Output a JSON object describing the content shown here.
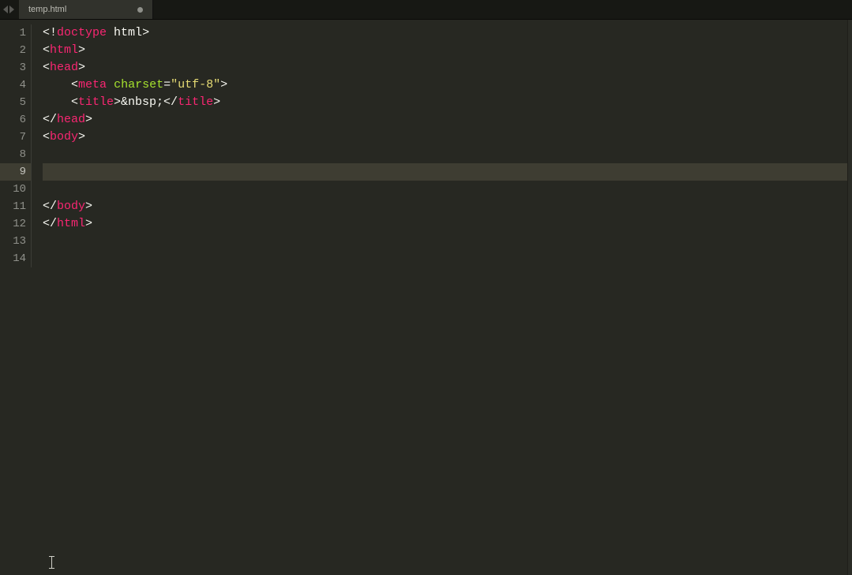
{
  "tabs": {
    "items": [
      {
        "label": "temp.html",
        "dirty": true,
        "active": true
      }
    ]
  },
  "editor": {
    "active_line": 9,
    "line_numbers": [
      "1",
      "2",
      "3",
      "4",
      "5",
      "6",
      "7",
      "8",
      "9",
      "10",
      "11",
      "12",
      "13",
      "14"
    ],
    "lines": [
      {
        "indent": 0,
        "tokens": [
          {
            "text": "<!",
            "cls": "c-white"
          },
          {
            "text": "doctype",
            "cls": "c-tag"
          },
          {
            "text": " ",
            "cls": "c-white"
          },
          {
            "text": "html",
            "cls": "c-white"
          },
          {
            "text": ">",
            "cls": "c-white"
          }
        ]
      },
      {
        "indent": 0,
        "tokens": [
          {
            "text": "<",
            "cls": "c-white"
          },
          {
            "text": "html",
            "cls": "c-tag"
          },
          {
            "text": ">",
            "cls": "c-white"
          }
        ]
      },
      {
        "indent": 0,
        "tokens": [
          {
            "text": "<",
            "cls": "c-white"
          },
          {
            "text": "head",
            "cls": "c-tag"
          },
          {
            "text": ">",
            "cls": "c-white"
          }
        ]
      },
      {
        "indent": 1,
        "tokens": [
          {
            "text": "<",
            "cls": "c-white"
          },
          {
            "text": "meta",
            "cls": "c-tag"
          },
          {
            "text": " ",
            "cls": "c-white"
          },
          {
            "text": "charset",
            "cls": "c-attr"
          },
          {
            "text": "=",
            "cls": "c-white"
          },
          {
            "text": "\"utf-8\"",
            "cls": "c-string"
          },
          {
            "text": ">",
            "cls": "c-white"
          }
        ]
      },
      {
        "indent": 1,
        "tokens": [
          {
            "text": "<",
            "cls": "c-white"
          },
          {
            "text": "title",
            "cls": "c-tag"
          },
          {
            "text": ">&nbsp;</",
            "cls": "c-white"
          },
          {
            "text": "title",
            "cls": "c-tag"
          },
          {
            "text": ">",
            "cls": "c-white"
          }
        ]
      },
      {
        "indent": 0,
        "tokens": [
          {
            "text": "</",
            "cls": "c-white"
          },
          {
            "text": "head",
            "cls": "c-tag"
          },
          {
            "text": ">",
            "cls": "c-white"
          }
        ]
      },
      {
        "indent": 0,
        "tokens": [
          {
            "text": "<",
            "cls": "c-white"
          },
          {
            "text": "body",
            "cls": "c-tag"
          },
          {
            "text": ">",
            "cls": "c-white"
          }
        ]
      },
      {
        "indent": 0,
        "tokens": []
      },
      {
        "indent": 0,
        "tokens": []
      },
      {
        "indent": 0,
        "tokens": []
      },
      {
        "indent": 0,
        "tokens": [
          {
            "text": "</",
            "cls": "c-white"
          },
          {
            "text": "body",
            "cls": "c-tag"
          },
          {
            "text": ">",
            "cls": "c-white"
          }
        ]
      },
      {
        "indent": 0,
        "tokens": [
          {
            "text": "</",
            "cls": "c-white"
          },
          {
            "text": "html",
            "cls": "c-tag"
          },
          {
            "text": ">",
            "cls": "c-white"
          }
        ]
      },
      {
        "indent": 0,
        "tokens": []
      },
      {
        "indent": 0,
        "tokens": []
      }
    ]
  },
  "colors": {
    "bg": "#272822",
    "tag": "#f92672",
    "attr": "#a6e22e",
    "string": "#e6db74"
  }
}
